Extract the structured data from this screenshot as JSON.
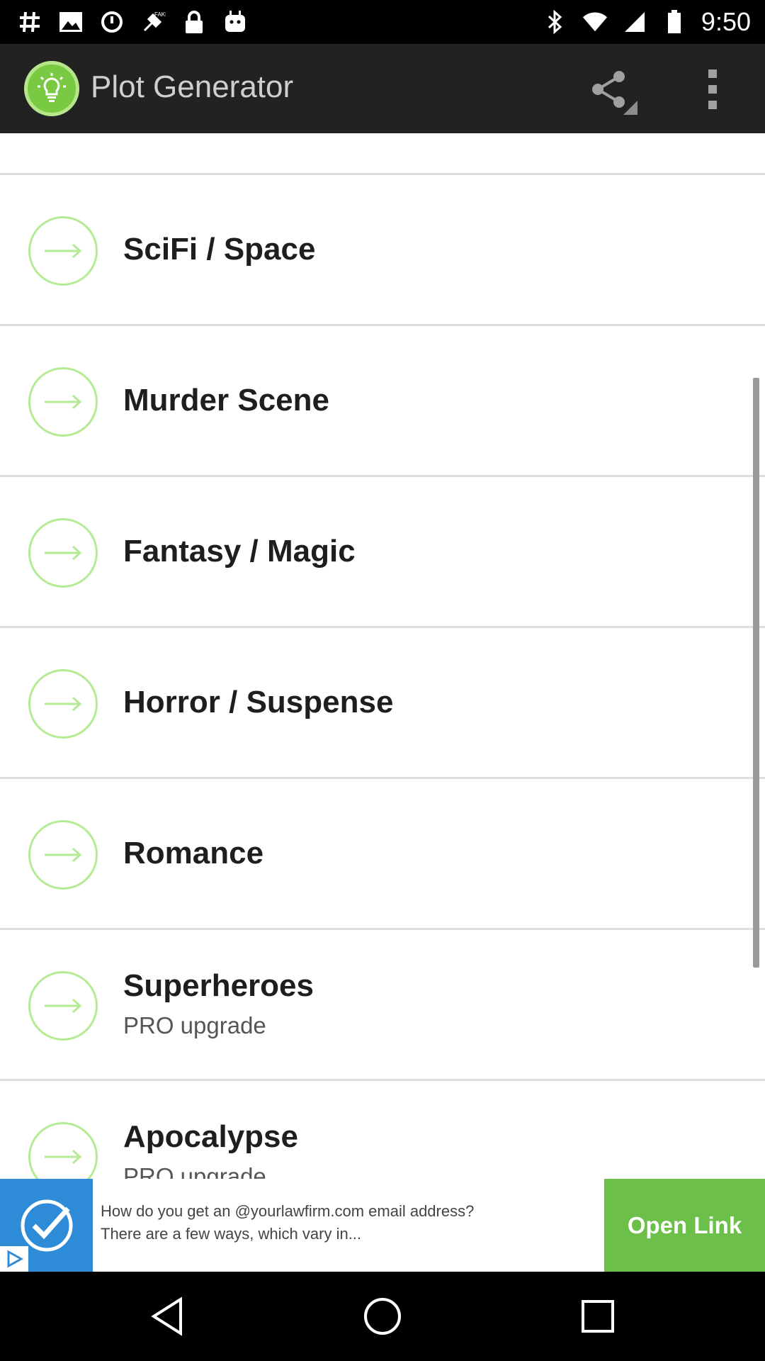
{
  "status_bar": {
    "time": "9:50",
    "left_icons": [
      "hashtag-icon",
      "image-icon",
      "alarm-icon",
      "fake-gps-icon",
      "lock-icon",
      "android-icon"
    ],
    "right_icons": [
      "bluetooth-icon",
      "wifi-icon",
      "signal-icon",
      "battery-icon"
    ]
  },
  "action_bar": {
    "title": "Plot Generator",
    "logo_icon": "lightbulb-icon",
    "share_icon": "share-icon",
    "overflow_icon": "more-vert-icon"
  },
  "list": {
    "items": [
      {
        "label": "SciFi / Space",
        "sublabel": ""
      },
      {
        "label": "Murder Scene",
        "sublabel": ""
      },
      {
        "label": "Fantasy / Magic",
        "sublabel": ""
      },
      {
        "label": "Horror / Suspense",
        "sublabel": ""
      },
      {
        "label": "Romance",
        "sublabel": ""
      },
      {
        "label": "Superheroes",
        "sublabel": "PRO upgrade"
      },
      {
        "label": "Apocalypse",
        "sublabel": "PRO upgrade"
      }
    ]
  },
  "ad": {
    "text_line1": "How do you get an @yourlawfirm.com email address?",
    "text_line2": "There are a few ways, which vary in...",
    "cta_label": "Open Link"
  },
  "colors": {
    "accent_green": "#7ac943",
    "arrow_ring": "#b5eb95",
    "action_bar": "#222222",
    "ad_blue": "#2e8bd8",
    "cta_green": "#6cc04a"
  }
}
